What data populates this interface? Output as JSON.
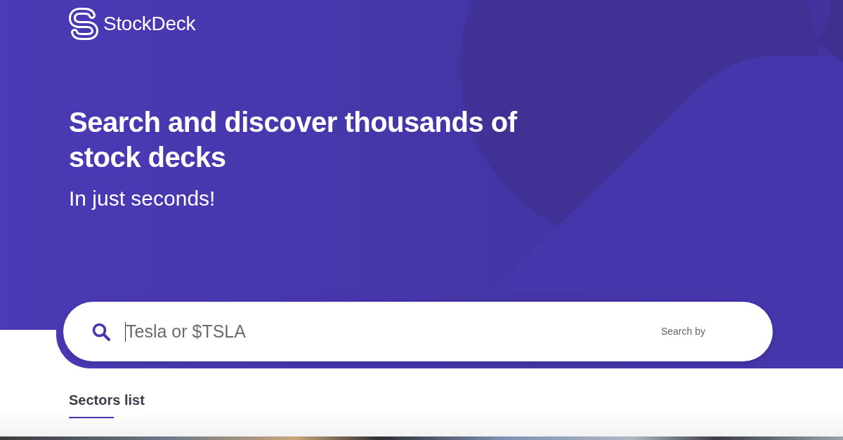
{
  "brand": {
    "name": "StockDeck"
  },
  "hero": {
    "title": "Search and discover thousands of stock decks",
    "subtitle": "In just seconds!"
  },
  "search": {
    "placeholder": "Tesla or $TSLA",
    "focused": true,
    "search_by_label": "Search by"
  },
  "sectors": {
    "title": "Sectors list"
  }
}
